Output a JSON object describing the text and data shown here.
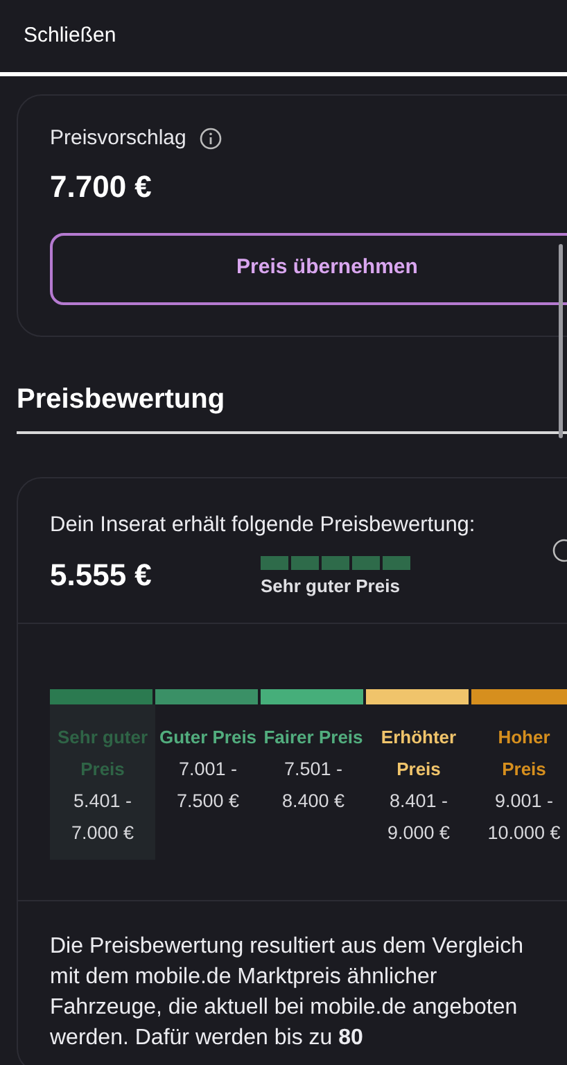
{
  "header": {
    "close_label": "Schließen"
  },
  "suggestion": {
    "label": "Preisvorschlag",
    "price": "7.700 €",
    "button": "Preis übernehmen"
  },
  "section_title": "Preisbewertung",
  "rating": {
    "intro": "Dein Inserat erhält folgende Preisbewertung:",
    "price": "5.555 €",
    "stars": 5,
    "rating_label": "Sehr guter Preis",
    "categories": [
      {
        "label": "Sehr guter Preis",
        "range": "5.401 - 7.000 €",
        "color": "#2b7a50",
        "selected": true
      },
      {
        "label": "Guter Preis",
        "range": "7.001 - 7.500 €",
        "color": "#3a9066",
        "selected": false
      },
      {
        "label": "Fairer Preis",
        "range": "7.501 - 8.400 €",
        "color": "#46ae7a",
        "selected": false
      },
      {
        "label": "Erhöhter Preis",
        "range": "8.401 - 9.000 €",
        "color": "#f0c46b",
        "selected": false
      },
      {
        "label": "Hoher Preis",
        "range": "9.001 - 10.000 €",
        "color": "#d68f1e",
        "selected": false
      }
    ],
    "explanation": "Die Preisbewertung resultiert aus dem Vergleich mit dem mobile.de Marktpreis ähnlicher Fahrzeuge, die aktuell bei mobile.de angeboten werden. Dafür werden bis zu **80**"
  }
}
